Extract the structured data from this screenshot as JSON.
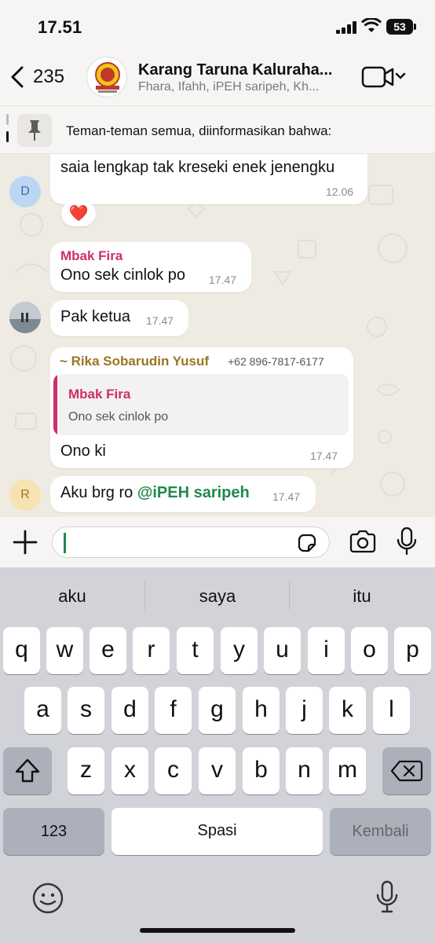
{
  "status_bar": {
    "time": "17.51",
    "battery": "53"
  },
  "header": {
    "back_count": "235",
    "title": "Karang Taruna Kaluraha...",
    "subtitle": "Fhara, Ifahh, iPEH saripeh, Kh..."
  },
  "pinned": {
    "text": "Teman-teman semua, diinformasikan bahwa:"
  },
  "messages": [
    {
      "avatar": "D",
      "text": "saia lengkap tak kreseki enek jenengku",
      "time": "12.06",
      "reaction": "❤️"
    },
    {
      "sender": "Mbak Fira",
      "text": "Ono sek cinlok po",
      "time": "17.47"
    },
    {
      "text": "Pak ketua",
      "time": "17.47"
    },
    {
      "sender": "~ Rika Sobarudin Yusuf",
      "phone": "+62 896-7817-6177",
      "quote_sender": "Mbak Fira",
      "quote_text": "Ono sek cinlok po",
      "text": "Ono ki",
      "time": "17.47"
    },
    {
      "avatar": "R",
      "text_prefix": "Aku brg ro ",
      "mention": "@iPEH saripeh",
      "time": "17.47"
    }
  ],
  "keyboard": {
    "suggestions": [
      "aku",
      "saya",
      "itu"
    ],
    "row1": [
      "q",
      "w",
      "e",
      "r",
      "t",
      "y",
      "u",
      "i",
      "o",
      "p"
    ],
    "row2": [
      "a",
      "s",
      "d",
      "f",
      "g",
      "h",
      "j",
      "k",
      "l"
    ],
    "row3": [
      "z",
      "x",
      "c",
      "v",
      "b",
      "n",
      "m"
    ],
    "numbers_key": "123",
    "space_key": "Spasi",
    "return_key": "Kembali"
  },
  "colors": {
    "accent": "#1f8a4c",
    "sender_pink": "#d12d6a",
    "sender_brown": "#9c7424"
  }
}
